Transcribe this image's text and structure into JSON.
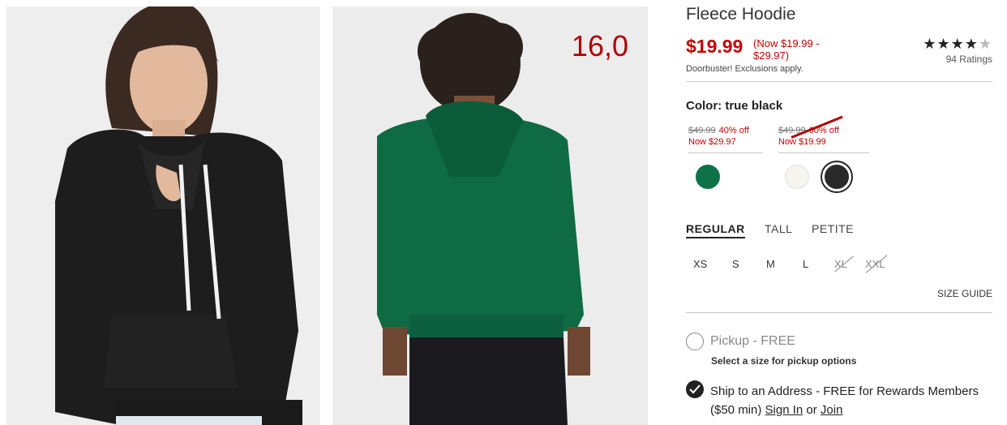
{
  "photos": {
    "left": {
      "alt_icon": "model-photo-black-hoodie"
    },
    "right": {
      "alt_icon": "model-photo-green-hoodie-back",
      "overlay": "16,0"
    }
  },
  "product": {
    "title": "Fleece Hoodie",
    "price_now": "$19.99",
    "price_range": "(Now $19.99 - $29.97)",
    "doorbuster": "Doorbuster! Exclusions apply.",
    "rating": {
      "stars": 4.5,
      "count_label": "94 Ratings"
    }
  },
  "color": {
    "label": "Color: true black",
    "groups": [
      {
        "old_price": "$49.99",
        "percent_off": "40% off",
        "now": "Now $29.97",
        "struck": false
      },
      {
        "old_price": "$49.99",
        "percent_off": "60% off",
        "now": "Now $19.99",
        "struck": true
      }
    ],
    "swatches": [
      {
        "name": "green",
        "color": "#0f7148"
      },
      {
        "name": "white",
        "color": "#f5f4ee"
      },
      {
        "name": "true black",
        "color": "#2a2a2a",
        "selected": true
      }
    ]
  },
  "fit": {
    "tabs": [
      "REGULAR",
      "TALL",
      "PETITE"
    ],
    "active": "REGULAR"
  },
  "sizes": {
    "items": [
      {
        "label": "XS",
        "available": true
      },
      {
        "label": "S",
        "available": true
      },
      {
        "label": "M",
        "available": true
      },
      {
        "label": "L",
        "available": true
      },
      {
        "label": "XL",
        "available": false
      },
      {
        "label": "XXL",
        "available": false
      }
    ],
    "guide_label": "SIZE GUIDE"
  },
  "fulfillment": {
    "pickup_label": "Pickup - FREE",
    "pickup_note": "Select a size for pickup options",
    "ship_label_prefix": "Ship to an Address - FREE for Rewards Members ($50 min)",
    "sign_in": "Sign In",
    "or": "or",
    "join": "Join"
  },
  "colors": {
    "sale_red": "#c50000",
    "text_dark": "#222222",
    "divider": "#c8c8c8"
  }
}
